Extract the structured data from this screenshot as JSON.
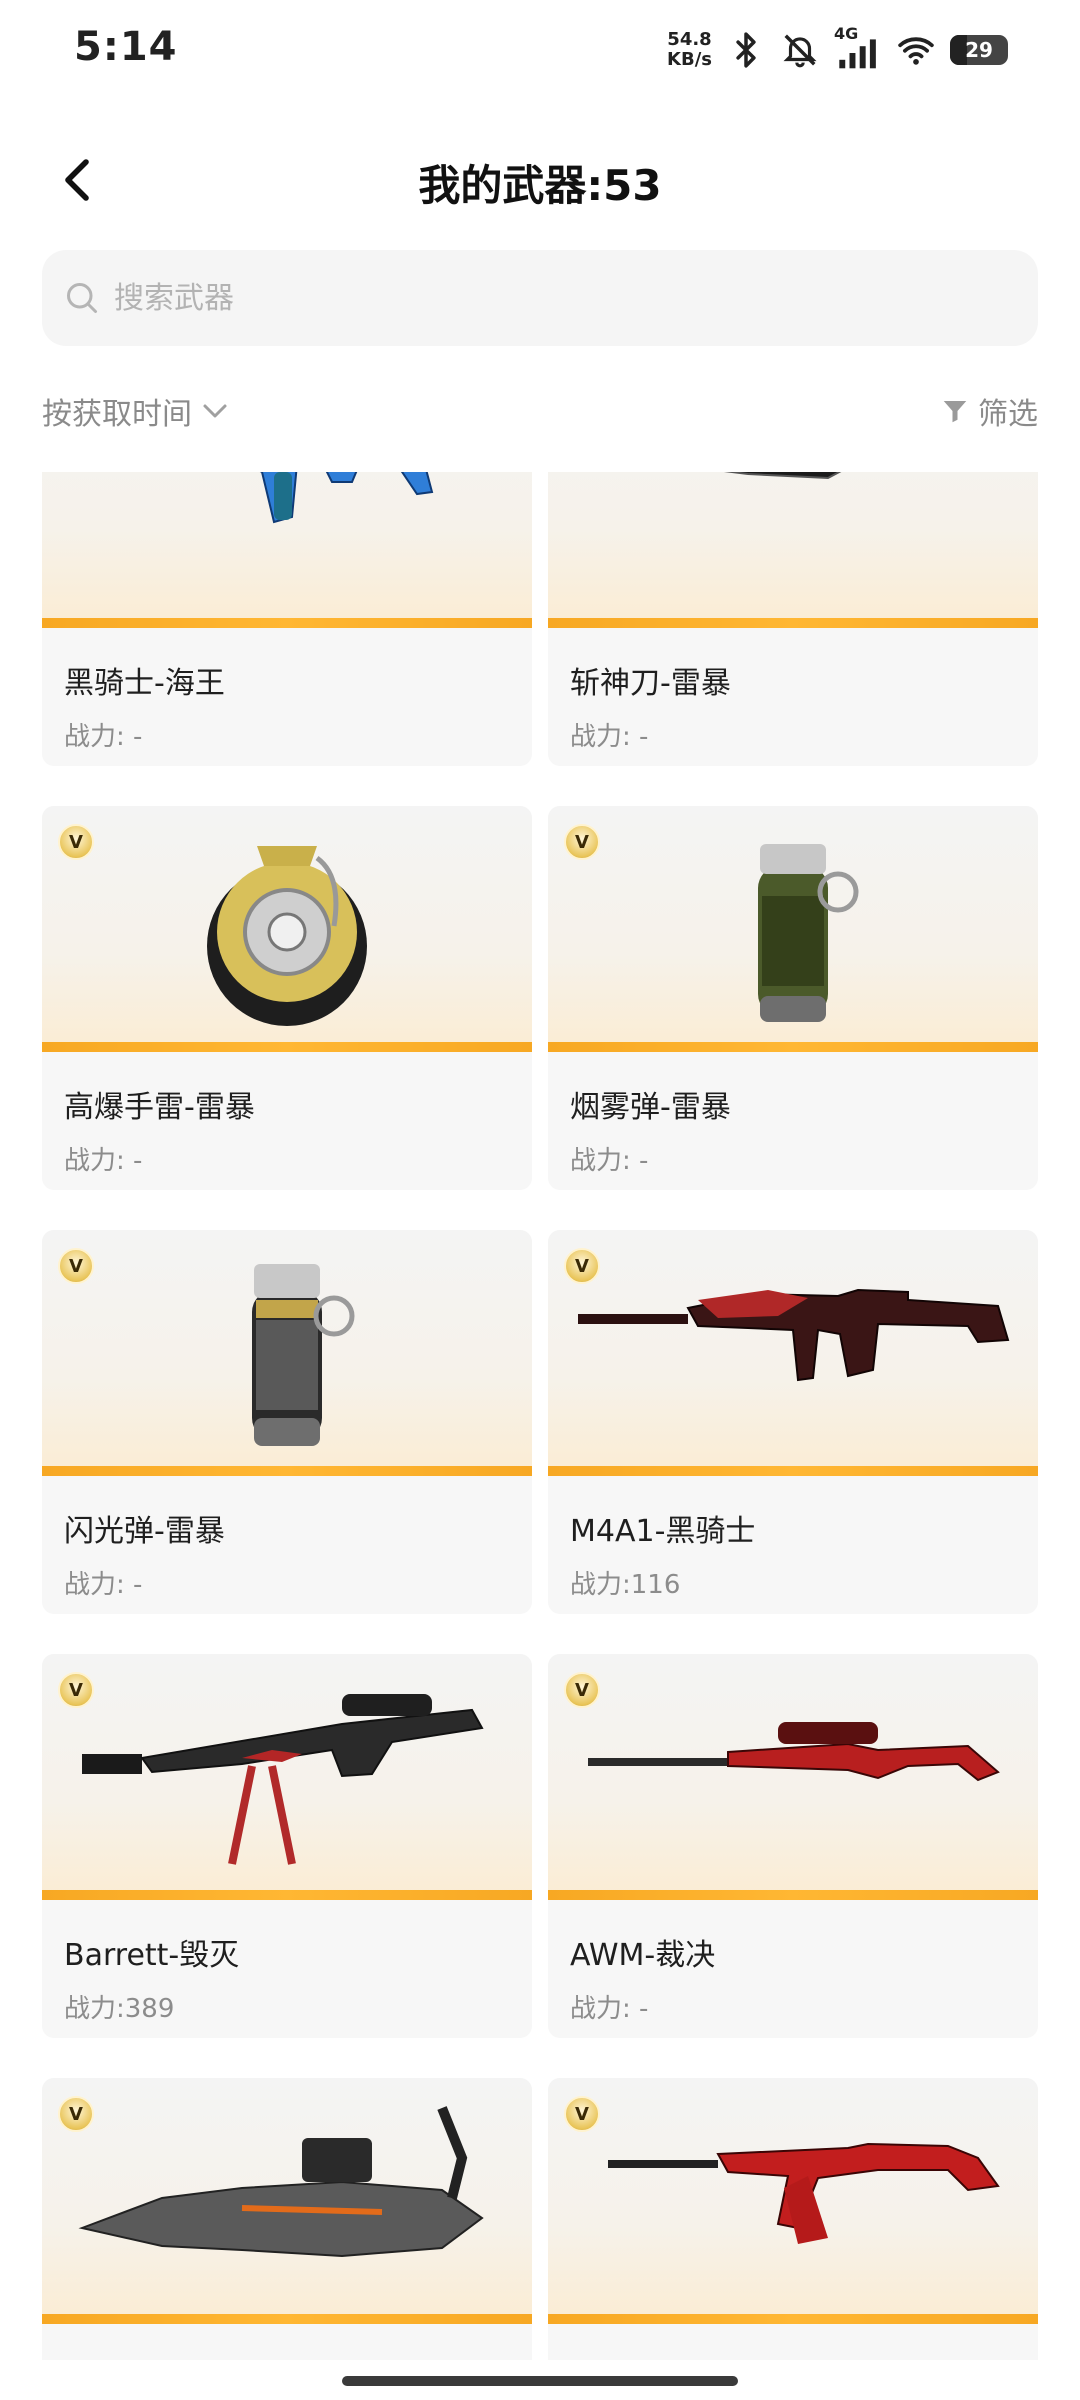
{
  "status_bar": {
    "time": "5:14",
    "net_speed_value": "54.8",
    "net_speed_unit": "KB/s",
    "network_type": "4G",
    "battery_level": "29",
    "icons": [
      "bluetooth-icon",
      "mute-icon",
      "signal-icon",
      "wifi-icon",
      "battery-icon"
    ]
  },
  "header": {
    "back_icon": "chevron-left-icon",
    "title": "我的武器:53"
  },
  "search": {
    "placeholder": "搜索武器",
    "value": ""
  },
  "sort": {
    "label": "按获取时间",
    "icon": "chevron-down-icon"
  },
  "filter": {
    "label": "筛选",
    "icon": "filter-icon"
  },
  "weapons": [
    {
      "name": "黑骑士-海王",
      "power": "战力: -",
      "vip": false,
      "art": "rifle-blue"
    },
    {
      "name": "斩神刀-雷暴",
      "power": "战力: -",
      "vip": false,
      "art": "blade-black-gold"
    },
    {
      "name": "高爆手雷-雷暴",
      "power": "战力: -",
      "vip": true,
      "art": "grenade-round"
    },
    {
      "name": "烟雾弹-雷暴",
      "power": "战力: -",
      "vip": true,
      "art": "grenade-smoke"
    },
    {
      "name": "闪光弹-雷暴",
      "power": "战力: -",
      "vip": true,
      "art": "grenade-flash"
    },
    {
      "name": "M4A1-黑骑士",
      "power": "战力:116",
      "vip": true,
      "art": "rifle-red"
    },
    {
      "name": "Barrett-毁灭",
      "power": "战力:389",
      "vip": true,
      "art": "sniper-barrett"
    },
    {
      "name": "AWM-裁决",
      "power": "战力: -",
      "vip": true,
      "art": "sniper-awm"
    },
    {
      "name": "",
      "power": "",
      "vip": true,
      "art": "dragon-gun"
    },
    {
      "name": "",
      "power": "",
      "vip": true,
      "art": "ak-red"
    }
  ],
  "vip_badge_label": "V",
  "colors": {
    "accent_orange": "#f7a823",
    "card_bg": "#f7f7f7",
    "muted_text": "#8c8c8c"
  }
}
